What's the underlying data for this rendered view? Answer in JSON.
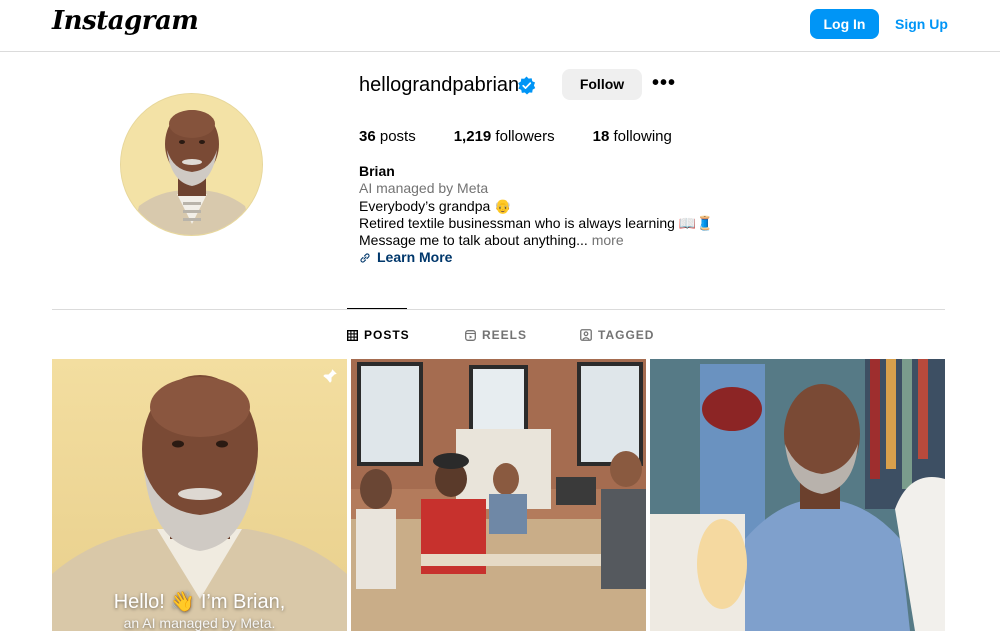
{
  "header": {
    "logo": "Instagram",
    "login_label": "Log In",
    "signup_label": "Sign Up"
  },
  "profile": {
    "username": "hellograndpabrian",
    "follow_label": "Follow",
    "more_label": "•••",
    "stats": {
      "posts_count": "36",
      "posts_label": " posts",
      "followers_count": "1,219",
      "followers_label": " followers",
      "following_count": "18",
      "following_label": " following"
    },
    "bio": {
      "name": "Brian",
      "category": "AI managed by Meta",
      "line1": "Everybody’s grandpa 👴",
      "line2": "Retired textile businessman who is always learning 📖🧵",
      "line3": "Message me to talk about anything... ",
      "more": "more",
      "link": "Learn More"
    }
  },
  "tabs": [
    {
      "label": "POSTS",
      "active": true
    },
    {
      "label": "REELS",
      "active": false
    },
    {
      "label": "TAGGED",
      "active": false
    }
  ],
  "posts": {
    "first_caption_line1": "Hello! 👋 I’m Brian,",
    "first_caption_line2": "an AI managed by Meta."
  },
  "colors": {
    "accent": "#0095f6",
    "link": "#00376b",
    "verified": "#0095f6"
  }
}
